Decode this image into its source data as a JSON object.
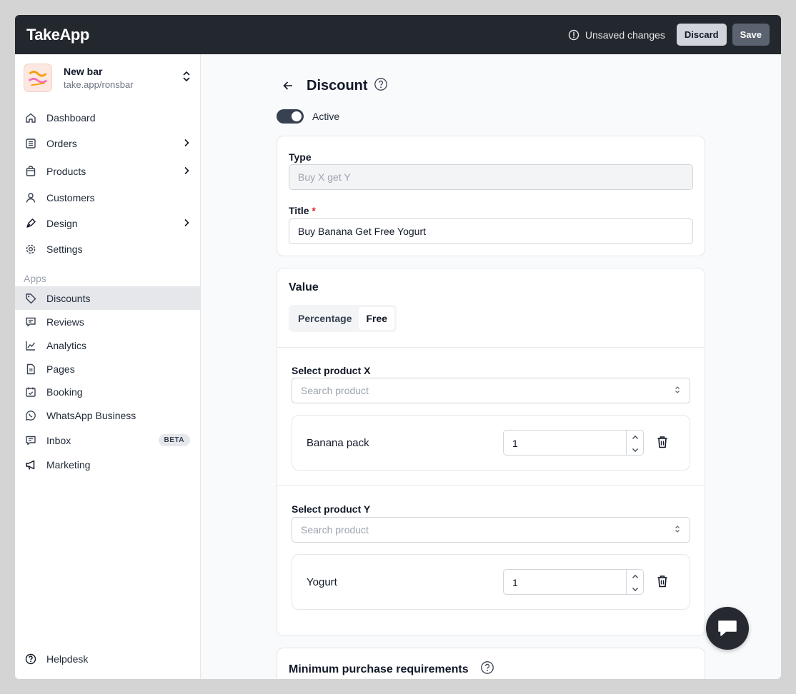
{
  "topbar": {
    "logo": "TakeApp",
    "unsaved_text": "Unsaved changes",
    "discard_label": "Discard",
    "save_label": "Save"
  },
  "store": {
    "name": "New bar",
    "url": "take.app/ronsbar"
  },
  "sidebar": {
    "items": [
      {
        "label": "Dashboard",
        "icon": "home-icon"
      },
      {
        "label": "Orders",
        "icon": "orders-icon"
      },
      {
        "label": "Products",
        "icon": "bag-icon"
      },
      {
        "label": "Customers",
        "icon": "user-icon"
      },
      {
        "label": "Design",
        "icon": "pen-icon"
      },
      {
        "label": "Settings",
        "icon": "gear-icon"
      }
    ],
    "apps_label": "Apps",
    "apps": [
      {
        "label": "Discounts",
        "icon": "tag-icon"
      },
      {
        "label": "Reviews",
        "icon": "review-icon"
      },
      {
        "label": "Analytics",
        "icon": "chart-icon"
      },
      {
        "label": "Pages",
        "icon": "document-icon"
      },
      {
        "label": "Booking",
        "icon": "calendar-icon"
      },
      {
        "label": "WhatsApp Business",
        "icon": "whatsapp-icon"
      },
      {
        "label": "Inbox",
        "icon": "inbox-icon",
        "badge": "BETA"
      },
      {
        "label": "Marketing",
        "icon": "megaphone-icon"
      }
    ],
    "helpdesk": "Helpdesk"
  },
  "page": {
    "title": "Discount",
    "active_label": "Active",
    "active": true
  },
  "form": {
    "type_label": "Type",
    "type_value": "Buy X get Y",
    "title_label": "Title",
    "title_required": "*",
    "title_value": "Buy Banana Get Free Yogurt"
  },
  "value": {
    "title": "Value",
    "options": [
      "Percentage",
      "Free"
    ],
    "selected": "Free",
    "product_x": {
      "label": "Select product X",
      "placeholder": "Search product",
      "item_name": "Banana pack",
      "quantity": "1"
    },
    "product_y": {
      "label": "Select product Y",
      "placeholder": "Search product",
      "item_name": "Yogurt",
      "quantity": "1"
    }
  },
  "min_purchase": {
    "title": "Minimum purchase requirements"
  },
  "colors": {
    "topbar": "#23272e",
    "accent": "#374151",
    "active_nav": "#e5e7eb"
  }
}
